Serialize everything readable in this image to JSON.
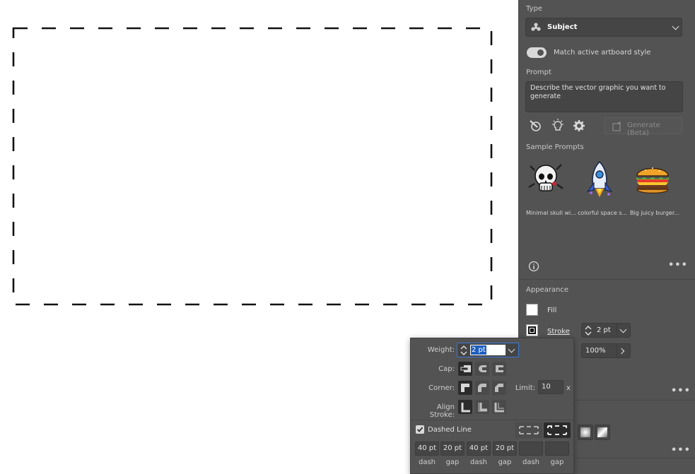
{
  "panel": {
    "type_label": "Type",
    "type_value": "Subject",
    "match_toggle_label": "Match active artboard style",
    "prompt_label": "Prompt",
    "prompt_placeholder": "Describe the vector graphic you want to generate",
    "generate_label": "Generate (Beta)",
    "sample_prompts_label": "Sample Prompts",
    "samples": [
      {
        "label": "Minimal skull wi...",
        "icon": "skull-icon"
      },
      {
        "label": "colorful space s...",
        "icon": "rocket-icon"
      },
      {
        "label": "Big juicy burger...",
        "icon": "burger-icon"
      }
    ],
    "appearance_label": "Appearance",
    "fill_label": "Fill",
    "stroke_label": "Stroke",
    "stroke_weight": "2 pt",
    "opacity": "100%"
  },
  "stroke_panel": {
    "weight_label": "Weight:",
    "weight_value": "2 pt",
    "cap_label": "Cap:",
    "corner_label": "Corner:",
    "limit_label": "Limit:",
    "limit_value": "10",
    "limit_unit": "x",
    "align_label": "Align Stroke:",
    "dashed_label": "Dashed Line",
    "dashed_checked": true,
    "dash_values": [
      "40 pt",
      "20 pt",
      "40 pt",
      "20 pt",
      "",
      ""
    ],
    "dash_labels": [
      "dash",
      "gap",
      "dash",
      "gap",
      "dash",
      "gap"
    ]
  },
  "colors": {
    "panel_bg": "#535353",
    "field_bg": "#454545",
    "selection": "#1f5fbf",
    "accent_toggle": "#d9d9d9"
  }
}
